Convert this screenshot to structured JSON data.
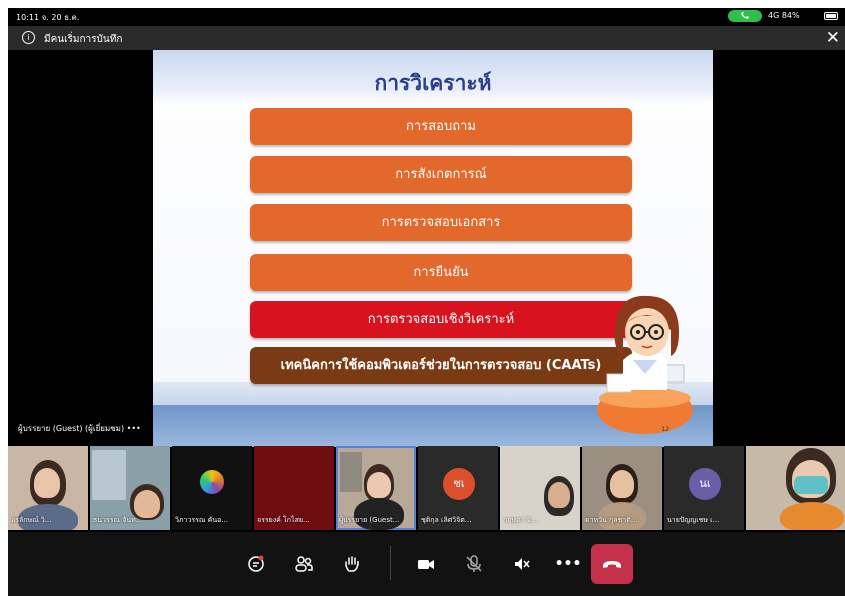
{
  "status_bar": {
    "time": "10:11 จ. 20 ธ.ค.",
    "network": "4G 84%"
  },
  "banner": {
    "text": "มีคนเริ่มการบันทึก"
  },
  "slide": {
    "title": "การวิเคราะห์",
    "items": [
      "การสอบถาม",
      "การสังเกตการณ์",
      "การตรวจสอบเอกสาร",
      "การยืนยัน",
      "การตรวจสอบเชิงวิเคราะห์",
      "เทคนิคการใช้คอมพิวเตอร์ช่วยในการตรวจสอบ (CAATs)"
    ],
    "page_number": "12"
  },
  "presenter_label": "ผู้บรรยาย (Guest) (ผู้เยี่ยมชม)  •••",
  "participants": [
    {
      "name": "อรลักษณ์ วิ..."
    },
    {
      "name": "ธนวรรณ จันท..."
    },
    {
      "name": "วิภาวรรณ คันอ..."
    },
    {
      "name": "จรรยงค์ โกไสย..."
    },
    {
      "name": "ผู้บรรยาย (Guest..."
    },
    {
      "name": "ชุติกุล เลิศวิจิต...",
      "initials": "ชเ",
      "color": "#d9502a"
    },
    {
      "name": "กฤษดา จิ..."
    },
    {
      "name": "ดาหวัน กุลชาติ..."
    },
    {
      "name": "นายปัญญเชษ เ...",
      "initials": "นเ",
      "color": "#6b5ea8"
    },
    {
      "name": ""
    }
  ],
  "toolbar": {
    "buttons": [
      "chat-icon",
      "people-icon",
      "raise-hand-icon",
      "camera-icon",
      "mic-off-icon",
      "speaker-off-icon",
      "more-icon",
      "hang-up-icon"
    ],
    "hangup_color": "#c4314b"
  }
}
